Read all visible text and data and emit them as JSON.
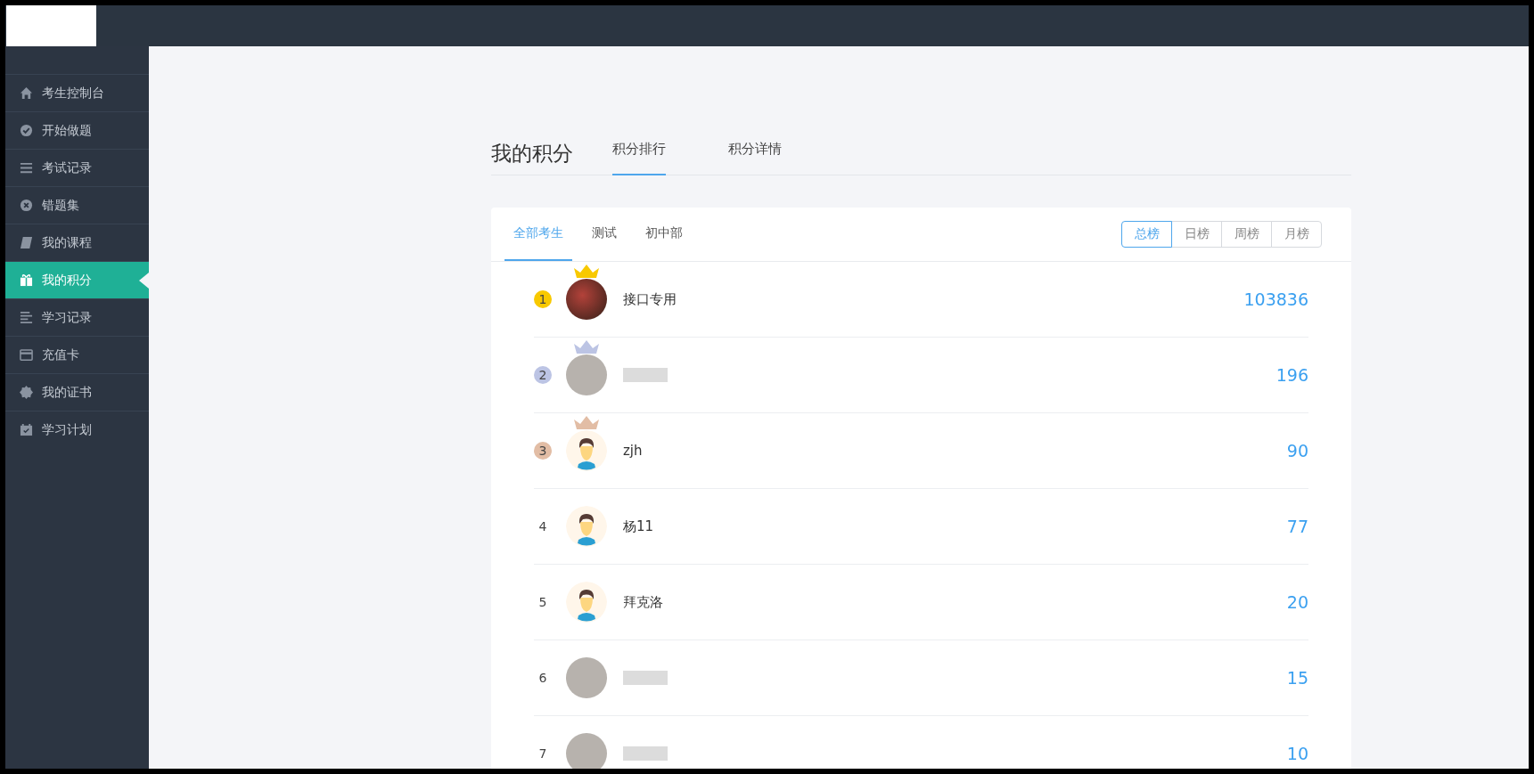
{
  "sidebar": {
    "items": [
      {
        "label": "考生控制台",
        "selected": false
      },
      {
        "label": "开始做题",
        "selected": false
      },
      {
        "label": "考试记录",
        "selected": false
      },
      {
        "label": "错题集",
        "selected": false
      },
      {
        "label": "我的课程",
        "selected": false
      },
      {
        "label": "我的积分",
        "selected": true
      },
      {
        "label": "学习记录",
        "selected": false
      },
      {
        "label": "充值卡",
        "selected": false
      },
      {
        "label": "我的证书",
        "selected": false
      },
      {
        "label": "学习计划",
        "selected": false
      }
    ]
  },
  "page": {
    "title": "我的积分",
    "tabs": [
      {
        "label": "积分排行",
        "selected": true
      },
      {
        "label": "积分详情",
        "selected": false
      }
    ]
  },
  "ranking": {
    "groups": [
      {
        "label": "全部考生",
        "selected": true
      },
      {
        "label": "测试",
        "selected": false
      },
      {
        "label": "初中部",
        "selected": false
      }
    ],
    "periods": [
      {
        "label": "总榜",
        "selected": true
      },
      {
        "label": "日榜",
        "selected": false
      },
      {
        "label": "周榜",
        "selected": false
      },
      {
        "label": "月榜",
        "selected": false
      }
    ],
    "rows": [
      {
        "rank": "1",
        "color": "#f8c900",
        "kind": "photo",
        "name": "接口专用",
        "score": "103836"
      },
      {
        "rank": "2",
        "color": "#bcc4e4",
        "kind": "blurred",
        "score": "196"
      },
      {
        "rank": "3",
        "color": "#e2bda5",
        "kind": "default",
        "name": "zjh",
        "score": "90"
      },
      {
        "rank": "4",
        "kind": "default",
        "name": "杨11",
        "score": "77"
      },
      {
        "rank": "5",
        "kind": "default",
        "name": "拜克洛",
        "score": "20"
      },
      {
        "rank": "6",
        "kind": "blurred",
        "score": "15"
      },
      {
        "rank": "7",
        "kind": "blurred",
        "score": "10"
      }
    ]
  }
}
